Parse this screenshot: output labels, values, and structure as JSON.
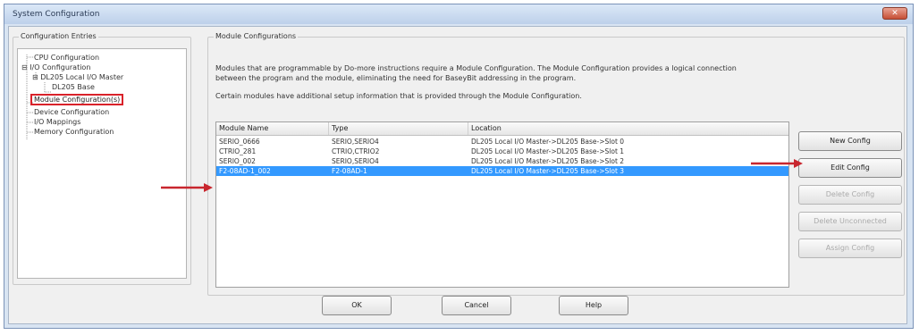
{
  "window": {
    "title": "System Configuration",
    "close_glyph": "✕"
  },
  "entries": {
    "title": "Configuration Entries",
    "tree": [
      {
        "label": "CPU Configuration"
      },
      {
        "label": "I/O Configuration",
        "expander": "⊟"
      },
      {
        "label": "DL205 Local I/O Master",
        "expander": "⊟"
      },
      {
        "label": "DL205 Base"
      },
      {
        "label": "Module Configuration(s)",
        "selected": true
      },
      {
        "label": "Device Configuration"
      },
      {
        "label": "I/O Mappings"
      },
      {
        "label": "Memory Configuration"
      }
    ]
  },
  "module": {
    "title": "Module Configurations",
    "description_lines": [
      "Modules that are programmable by Do-more instructions require a Module Configuration.  The Module Configuration provides a logical connection",
      "between the program and the module, eliminating the need for BaseyBit addressing in the program.",
      "Certain modules have additional setup information that is provided through the Module Configuration."
    ],
    "table": {
      "columns": [
        "Module Name",
        "Type",
        "Location"
      ],
      "rows": [
        {
          "name": "SERIO_0666",
          "type": "SERIO,SERIO4",
          "location": "DL205 Local I/O Master->DL205 Base->Slot 0",
          "selected": false
        },
        {
          "name": "CTRIO_281",
          "type": "CTRIO,CTRIO2",
          "location": "DL205 Local I/O Master->DL205 Base->Slot 1",
          "selected": false
        },
        {
          "name": "SERIO_002",
          "type": "SERIO,SERIO4",
          "location": "DL205 Local I/O Master->DL205 Base->Slot 2",
          "selected": false
        },
        {
          "name": "F2-08AD-1_002",
          "type": "F2-08AD-1",
          "location": "DL205 Local I/O Master->DL205 Base->Slot 3",
          "selected": true
        }
      ]
    },
    "buttons": {
      "new_config": "New Config",
      "edit_config": "Edit Config",
      "delete_config": "Delete Config",
      "delete_unconnected": "Delete Unconnected",
      "assign_config": "Assign Config"
    }
  },
  "footer": {
    "ok": "OK",
    "cancel": "Cancel",
    "help": "Help"
  },
  "colors": {
    "highlight": "#3399ff",
    "callout": "#d9222a"
  }
}
